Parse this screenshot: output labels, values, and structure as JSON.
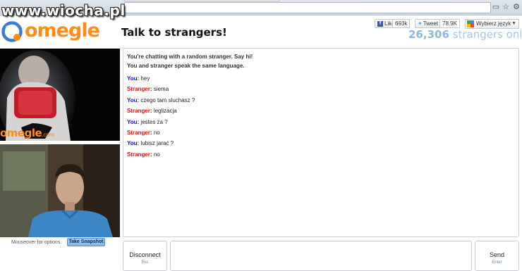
{
  "watermark": "www.wiocha.pl",
  "header": {
    "logo_text": "omegle",
    "tagline": "Talk to strangers!",
    "online_count": "26,306",
    "online_suffix": "strangers online"
  },
  "social": {
    "like_label": "Like",
    "like_count": "693k",
    "tweet_label": "Tweet",
    "tweet_count": "78.9K",
    "language_label": "Wybierz język",
    "language_arrow": "▼"
  },
  "video": {
    "overlay_brand": "omegle",
    "overlay_domain": ".com",
    "mouseover_hint": "Mouseover for options.",
    "snapshot_label": "Take Snapshot"
  },
  "chat": {
    "system_messages": [
      "You're chatting with a random stranger. Say hi!",
      "You and stranger speak the same language."
    ],
    "messages": [
      {
        "sender": "You",
        "text": "hey"
      },
      {
        "sender": "Stranger",
        "text": "siema"
      },
      {
        "sender": "You",
        "text": "czego tam sluchasz ?"
      },
      {
        "sender": "Stranger",
        "text": "leglizacja"
      },
      {
        "sender": "You",
        "text": "jestes za ?"
      },
      {
        "sender": "Stranger",
        "text": "no"
      },
      {
        "sender": "You",
        "text": "lubisz jarać ?"
      },
      {
        "sender": "Stranger",
        "text": "no"
      }
    ]
  },
  "controls": {
    "disconnect_label": "Disconnect",
    "disconnect_key": "Esc",
    "send_label": "Send",
    "send_key": "Enter",
    "message_value": ""
  },
  "colors": {
    "brand_orange": "#ff8c1a",
    "you_color": "#1111dd",
    "stranger_color": "#dd1111",
    "online_blue": "#8fb5e2"
  }
}
